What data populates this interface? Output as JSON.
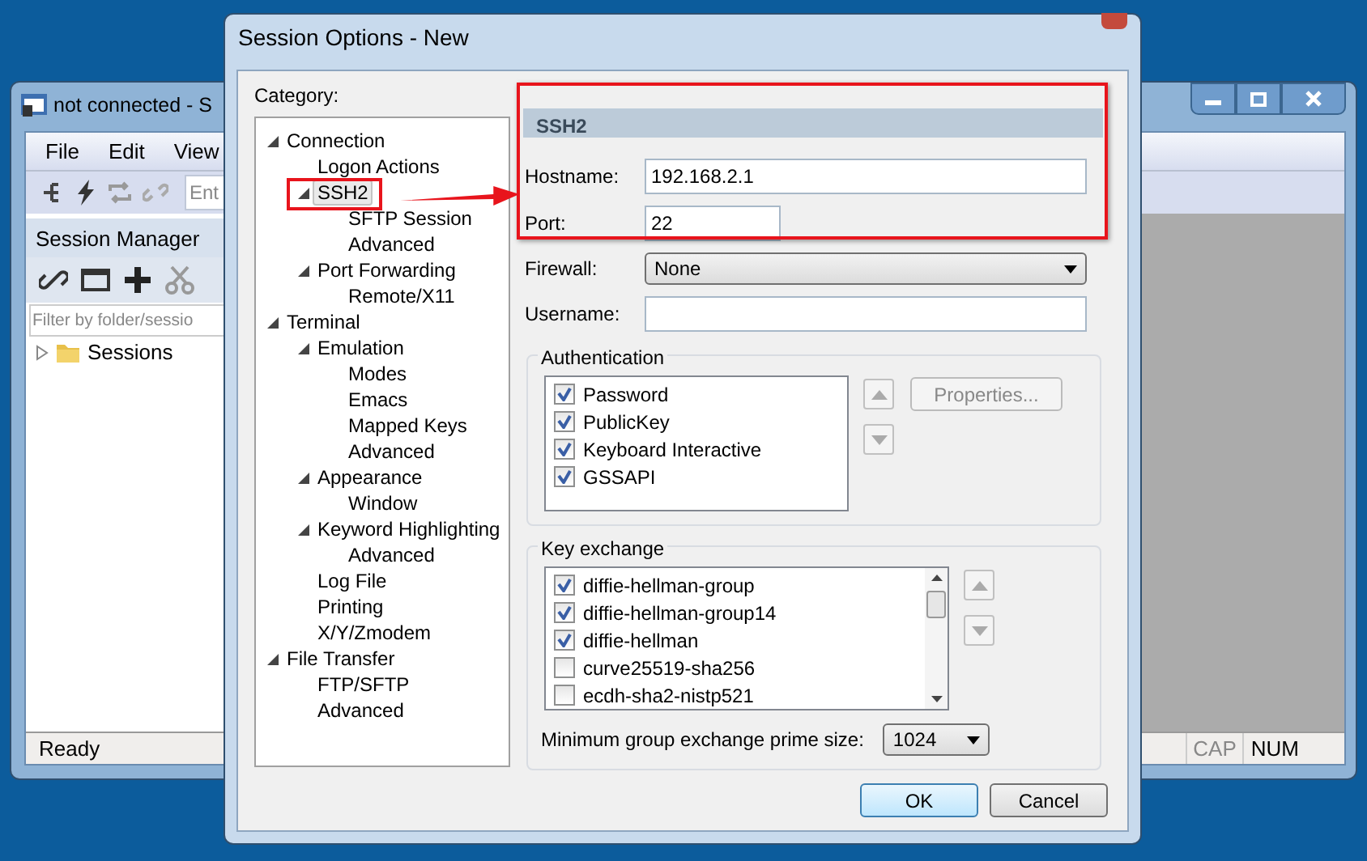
{
  "main_window": {
    "title": "not connected - S",
    "menu": [
      "File",
      "Edit",
      "View"
    ],
    "address_placeholder": "Ent",
    "session_manager": {
      "title": "Session Manager",
      "filter_placeholder": "Filter by folder/sessio",
      "tree": [
        {
          "label": "Sessions",
          "expanded": false
        }
      ]
    },
    "status_bar": {
      "text": "Ready",
      "indicators": [
        {
          "label": "CAP",
          "on": false
        },
        {
          "label": "NUM",
          "on": true
        }
      ]
    }
  },
  "dialog": {
    "title": "Session Options - New",
    "category_label": "Category:",
    "categories": [
      {
        "label": "Connection",
        "expanded": true,
        "selected": false,
        "children": [
          {
            "label": "Logon Actions",
            "selected": false
          },
          {
            "label": "SSH2",
            "expanded": true,
            "selected": true,
            "children": [
              {
                "label": "SFTP Session",
                "selected": false
              },
              {
                "label": "Advanced",
                "selected": false
              }
            ]
          },
          {
            "label": "Port Forwarding",
            "expanded": true,
            "selected": false,
            "children": [
              {
                "label": "Remote/X11",
                "selected": false
              }
            ]
          }
        ]
      },
      {
        "label": "Terminal",
        "expanded": true,
        "selected": false,
        "children": [
          {
            "label": "Emulation",
            "expanded": true,
            "selected": false,
            "children": [
              {
                "label": "Modes",
                "selected": false
              },
              {
                "label": "Emacs",
                "selected": false
              },
              {
                "label": "Mapped Keys",
                "selected": false
              },
              {
                "label": "Advanced",
                "selected": false
              }
            ]
          },
          {
            "label": "Appearance",
            "expanded": true,
            "selected": false,
            "children": [
              {
                "label": "Window",
                "selected": false
              }
            ]
          },
          {
            "label": "Keyword Highlighting",
            "expanded": true,
            "selected": false,
            "children": [
              {
                "label": "Advanced",
                "selected": false
              }
            ]
          },
          {
            "label": "Log File",
            "selected": false
          },
          {
            "label": "Printing",
            "selected": false
          },
          {
            "label": "X/Y/Zmodem",
            "selected": false
          }
        ]
      },
      {
        "label": "File Transfer",
        "expanded": true,
        "selected": false,
        "children": [
          {
            "label": "FTP/SFTP",
            "selected": false
          },
          {
            "label": "Advanced",
            "selected": false
          }
        ]
      }
    ],
    "section_title": "SSH2",
    "fields": [
      {
        "label": "Hostname:",
        "kind": "text",
        "value": "192.168.2.1"
      },
      {
        "label": "Port:",
        "kind": "number",
        "value": "22"
      },
      {
        "label": "Firewall:",
        "kind": "select",
        "value": "None"
      },
      {
        "label": "Username:",
        "kind": "text"
      }
    ],
    "authentication": {
      "title": "Authentication",
      "methods": [
        {
          "label": "Password",
          "checked": true
        },
        {
          "label": "PublicKey",
          "checked": true
        },
        {
          "label": "Keyboard Interactive",
          "checked": true
        },
        {
          "label": "GSSAPI",
          "checked": true
        }
      ],
      "properties_button": {
        "label": "Properties...",
        "disabled": true
      }
    },
    "key_exchange": {
      "title": "Key exchange",
      "algorithms": [
        {
          "label": "diffie-hellman-group",
          "checked": true
        },
        {
          "label": "diffie-hellman-group14",
          "checked": true
        },
        {
          "label": "diffie-hellman",
          "checked": true
        },
        {
          "label": "curve25519-sha256",
          "checked": false
        },
        {
          "label": "ecdh-sha2-nistp521",
          "checked": false
        }
      ],
      "prime_size_label": "Minimum group exchange prime size:",
      "prime_size": "1024"
    },
    "buttons": [
      {
        "label": "OK",
        "default": true
      },
      {
        "label": "Cancel",
        "default": false
      }
    ]
  }
}
